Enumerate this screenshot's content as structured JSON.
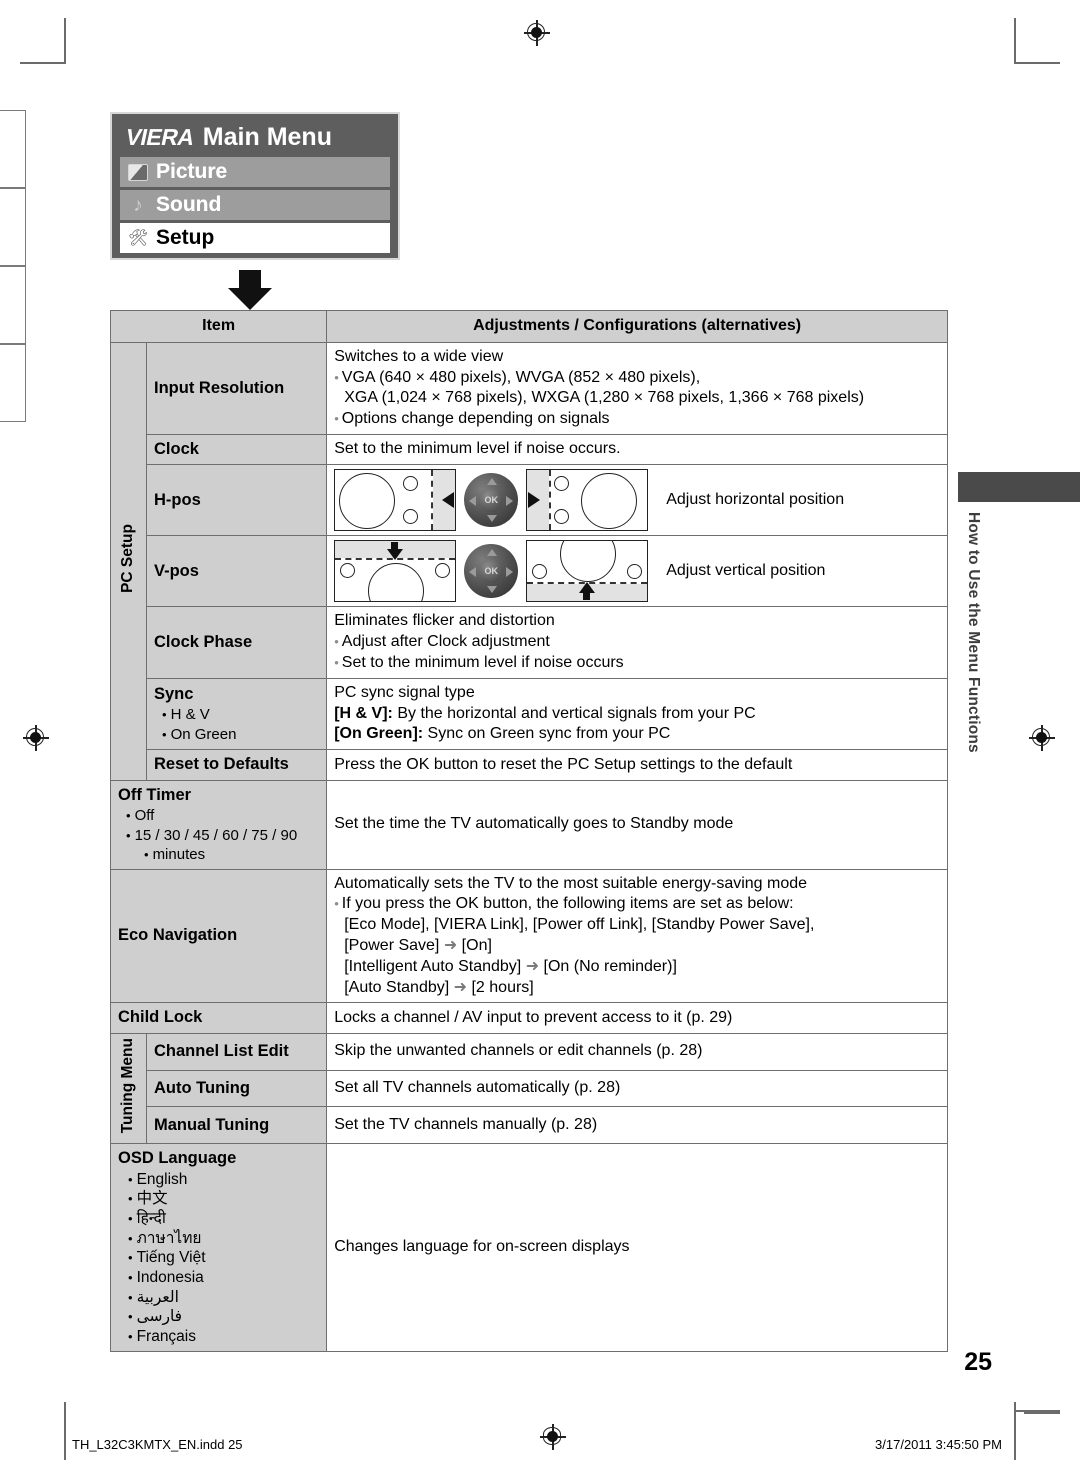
{
  "menu_box": {
    "logo": "VIERA",
    "title": "Main Menu",
    "items": [
      {
        "label": "Picture",
        "icon": "picture-icon",
        "selected": false
      },
      {
        "label": "Sound",
        "icon": "sound-note-icon",
        "selected": false
      },
      {
        "label": "Setup",
        "icon": "setup-wrench-icon",
        "selected": true
      }
    ]
  },
  "table": {
    "headers": {
      "item": "Item",
      "desc": "Adjustments / Configurations (alternatives)"
    },
    "groups": {
      "pc_setup": "PC Setup",
      "tuning_menu": "Tuning Menu"
    },
    "rows": {
      "input_resolution": {
        "item": "Input Resolution",
        "line1": "Switches to a wide view",
        "bullet1a": "VGA (640 × 480 pixels), WVGA (852 × 480 pixels),",
        "bullet1b": "XGA (1,024 × 768 pixels), WXGA (1,280 × 768 pixels, 1,366 × 768 pixels)",
        "bullet2": "Options change depending on signals"
      },
      "clock": {
        "item": "Clock",
        "desc": "Set to the minimum level if noise occurs."
      },
      "h_pos": {
        "item": "H-pos",
        "desc": "Adjust horizontal position"
      },
      "v_pos": {
        "item": "V-pos",
        "desc": "Adjust vertical position"
      },
      "clock_phase": {
        "item": "Clock Phase",
        "line1": "Eliminates flicker and distortion",
        "bullet1": "Adjust after Clock adjustment",
        "bullet2": "Set to the minimum level if noise occurs"
      },
      "sync": {
        "item": "Sync",
        "option1": "H & V",
        "option2": "On Green",
        "line1": "PC sync signal type",
        "line2_bold": "[H & V]:",
        "line2_rest": " By the horizontal and vertical signals from your PC",
        "line3_bold": "[On Green]:",
        "line3_rest": " Sync on Green sync from your PC"
      },
      "reset_to_defaults": {
        "item": "Reset to Defaults",
        "desc": "Press the OK button to reset the PC Setup settings to the default"
      },
      "off_timer": {
        "item": "Off Timer",
        "option1": "Off",
        "option2": "15 / 30 / 45 / 60 / 75 / 90",
        "option2_cont": "minutes",
        "desc": "Set the time the TV automatically goes to Standby mode"
      },
      "eco_navigation": {
        "item": "Eco Navigation",
        "line1": "Automatically sets the TV to the most suitable energy-saving mode",
        "bullet1": "If you press the OK button, the following items are set as below:",
        "cont1": "[Eco Mode], [VIERA Link], [Power off Link], [Standby Power Save],",
        "cont2_a": "[Power Save] ",
        "cont2_b": " [On]",
        "cont3_a": "[Intelligent Auto Standby] ",
        "cont3_b": " [On (No reminder)]",
        "cont4_a": "[Auto Standby] ",
        "cont4_b": " [2 hours]",
        "arrow_glyph": "➜"
      },
      "child_lock": {
        "item": "Child Lock",
        "desc": "Locks a channel / AV input to prevent access to it (p. 29)"
      },
      "channel_list_edit": {
        "item": "Channel List Edit",
        "desc": "Skip the unwanted channels or edit channels (p. 28)"
      },
      "auto_tuning": {
        "item": "Auto Tuning",
        "desc": "Set all TV channels automatically (p. 28)"
      },
      "manual_tuning": {
        "item": "Manual Tuning",
        "desc": "Set the TV channels manually (p. 28)"
      },
      "osd_language": {
        "item": "OSD Language",
        "desc": "Changes language for on-screen displays",
        "languages": [
          "English",
          "中文",
          "हिन्दी",
          "ภาษาไทย",
          "Tiếng Việt",
          "Indonesia",
          "العربية",
          "فارسى",
          "Français"
        ]
      }
    }
  },
  "side_tab": {
    "label": "How to Use the Menu Functions"
  },
  "page_number": "25",
  "footer": {
    "file": "TH_L32C3KMTX_EN.indd   25",
    "timestamp": "3/17/2011   3:45:50 PM"
  }
}
